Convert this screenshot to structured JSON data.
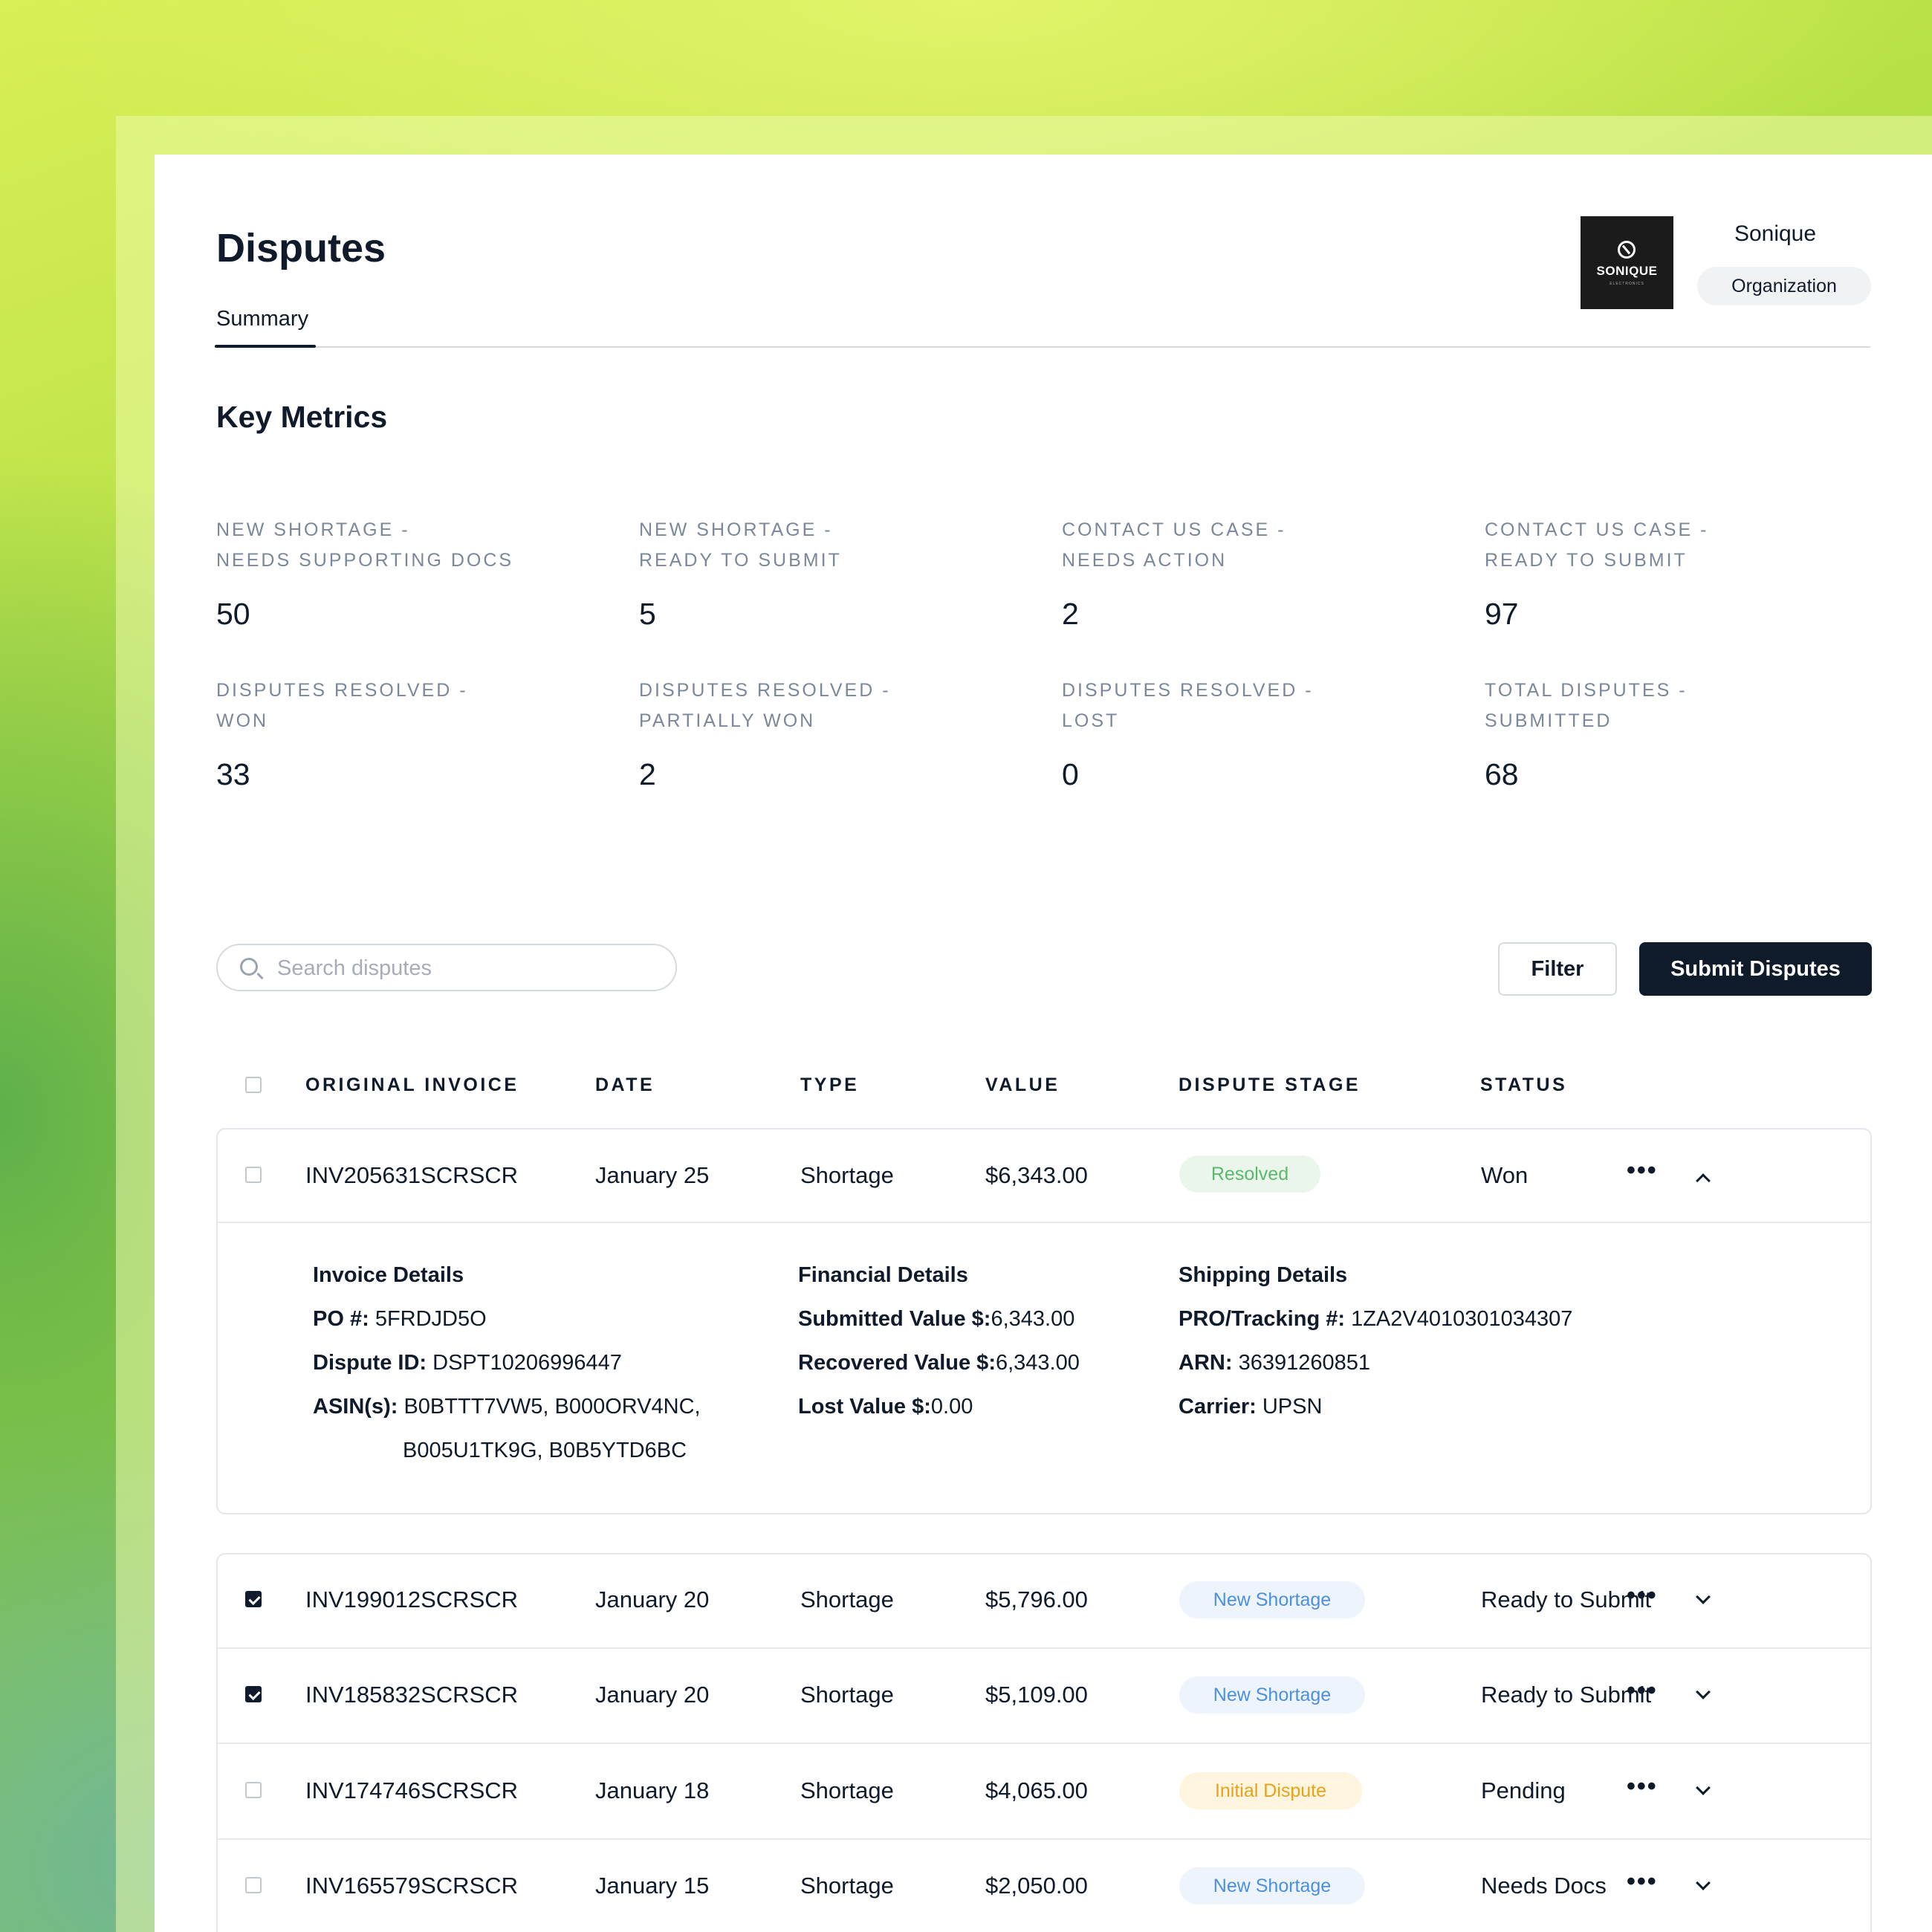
{
  "header": {
    "title": "Disputes",
    "tab": "Summary",
    "org_name": "Sonique",
    "org_role": "Organization",
    "logo_word": "SONIQUE",
    "logo_sub": "ELECTRONICS"
  },
  "metrics": {
    "title": "Key Metrics",
    "items": [
      {
        "label1": "NEW SHORTAGE -",
        "label2": "NEEDS SUPPORTING DOCS",
        "value": "50"
      },
      {
        "label1": "NEW SHORTAGE -",
        "label2": "READY TO SUBMIT",
        "value": "5"
      },
      {
        "label1": "CONTACT US CASE -",
        "label2": "NEEDS ACTION",
        "value": "2"
      },
      {
        "label1": "CONTACT US CASE -",
        "label2": "READY TO SUBMIT",
        "value": "97"
      },
      {
        "label1": "DISPUTES RESOLVED -",
        "label2": "WON",
        "value": "33"
      },
      {
        "label1": "DISPUTES RESOLVED -",
        "label2": "PARTIALLY WON",
        "value": "2"
      },
      {
        "label1": "DISPUTES RESOLVED -",
        "label2": "LOST",
        "value": "0"
      },
      {
        "label1": "TOTAL DISPUTES -",
        "label2": "SUBMITTED",
        "value": "68"
      }
    ]
  },
  "toolbar": {
    "search_placeholder": "Search disputes",
    "filter_label": "Filter",
    "submit_label": "Submit Disputes"
  },
  "table": {
    "columns": [
      "ORIGINAL INVOICE",
      "DATE",
      "TYPE",
      "VALUE",
      "DISPUTE STAGE",
      "STATUS"
    ],
    "rows": [
      {
        "invoice": "INV205631SCRSCR",
        "date": "January 25",
        "type": "Shortage",
        "value": "$6,343.00",
        "stage": "Resolved",
        "status": "Won",
        "checked": false,
        "expanded": true
      },
      {
        "invoice": "INV199012SCRSCR",
        "date": "January 20",
        "type": "Shortage",
        "value": "$5,796.00",
        "stage": "New Shortage",
        "status": "Ready to Submit",
        "checked": true,
        "expanded": false
      },
      {
        "invoice": "INV185832SCRSCR",
        "date": "January 20",
        "type": "Shortage",
        "value": "$5,109.00",
        "stage": "New Shortage",
        "status": "Ready to Submit",
        "checked": true,
        "expanded": false
      },
      {
        "invoice": "INV174746SCRSCR",
        "date": "January 18",
        "type": "Shortage",
        "value": "$4,065.00",
        "stage": "Initial Dispute",
        "status": "Pending",
        "checked": false,
        "expanded": false
      },
      {
        "invoice": "INV165579SCRSCR",
        "date": "January 15",
        "type": "Shortage",
        "value": "$2,050.00",
        "stage": "New Shortage",
        "status": "Needs Docs",
        "checked": false,
        "expanded": false
      }
    ],
    "more_glyph": "•••"
  },
  "details": {
    "invoice": {
      "heading": "Invoice Details",
      "po_label": "PO #:",
      "po": "5FRDJD5O",
      "dispute_label": "Dispute ID:",
      "dispute_id": "DSPT10206996447",
      "asin_label": "ASIN(s):",
      "asin_line1": "B0BTTT7VW5, B000ORV4NC,",
      "asin_line2": "B005U1TK9G, B0B5YTD6BC"
    },
    "financial": {
      "heading": "Financial Details",
      "submitted_label": "Submitted Value $:",
      "submitted": "6,343.00",
      "recovered_label": "Recovered Value $:",
      "recovered": "6,343.00",
      "lost_label": "Lost Value $:",
      "lost": "0.00"
    },
    "shipping": {
      "heading": "Shipping Details",
      "pro_label": "PRO/Tracking #:",
      "pro": "1ZA2V4010301034307",
      "arn_label": "ARN:",
      "arn": "36391260851",
      "carrier_label": "Carrier:",
      "carrier": "UPSN"
    }
  },
  "colors": {
    "resolved_bg": "#eaf6ec",
    "resolved_text": "#5cb86a",
    "new_bg": "#eef4fc",
    "new_text": "#4c8fe0",
    "initial_bg": "#fff5df",
    "initial_text": "#e6a21b",
    "primary": "#0f1a2a"
  }
}
